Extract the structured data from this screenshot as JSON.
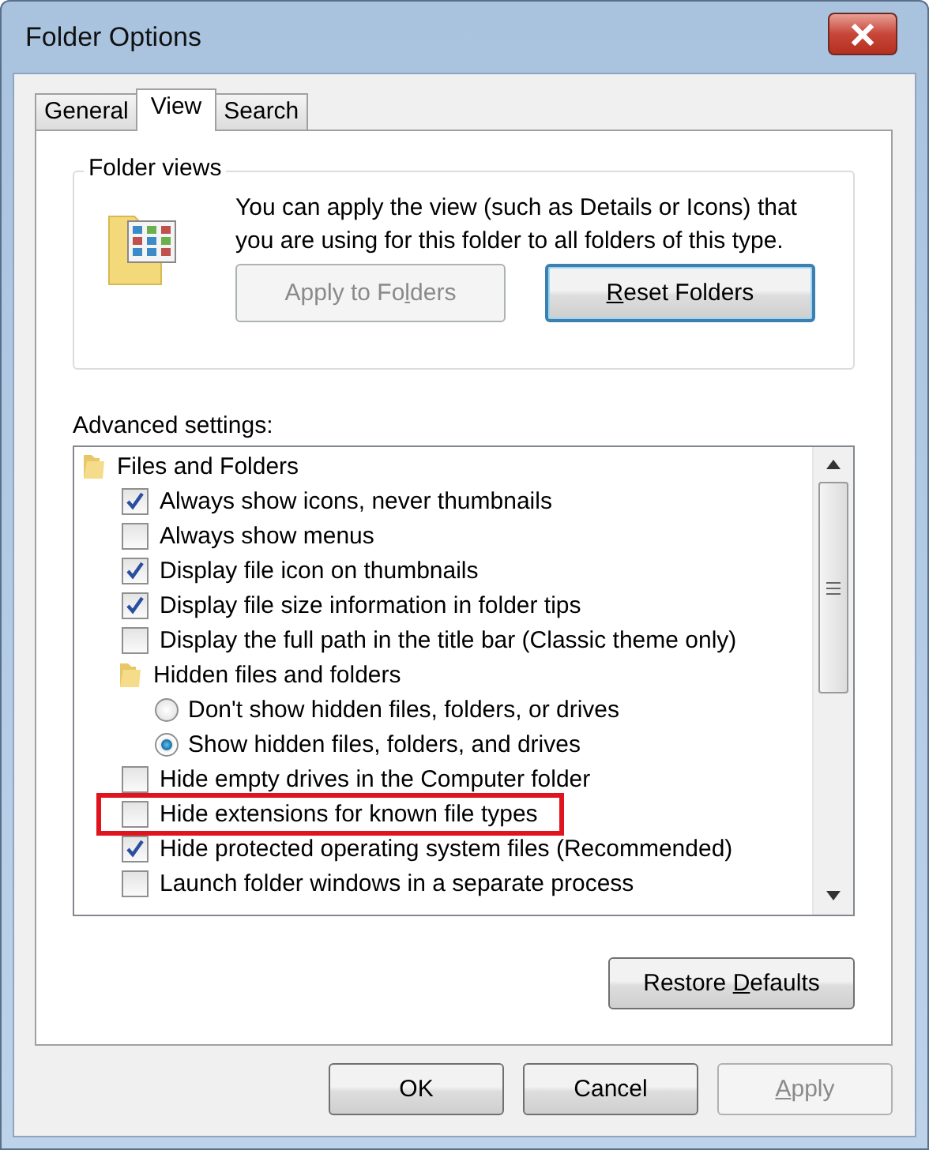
{
  "window": {
    "title": "Folder Options"
  },
  "tabs": [
    {
      "label": "General",
      "selected": false
    },
    {
      "label": "View",
      "selected": true
    },
    {
      "label": "Search",
      "selected": false
    }
  ],
  "folder_views": {
    "title": "Folder views",
    "description": "You can apply the view (such as Details or Icons) that you are using for this folder to all folders of this type.",
    "buttons": [
      {
        "pre": "Apply to Fo",
        "key": "l",
        "post": "ders",
        "disabled": true,
        "default": false
      },
      {
        "key": "R",
        "post": "eset Folders",
        "disabled": false,
        "default": true
      }
    ]
  },
  "advanced": {
    "label": "Advanced settings:",
    "items": [
      {
        "kind": "group",
        "label": "Files and Folders",
        "children": [
          {
            "kind": "checkbox",
            "label": "Always show icons, never thumbnails",
            "checked": true,
            "highlighted": false
          },
          {
            "kind": "checkbox",
            "label": "Always show menus",
            "checked": false,
            "highlighted": false
          },
          {
            "kind": "checkbox",
            "label": "Display file icon on thumbnails",
            "checked": true,
            "highlighted": false
          },
          {
            "kind": "checkbox",
            "label": "Display file size information in folder tips",
            "checked": true,
            "highlighted": false
          },
          {
            "kind": "checkbox",
            "label": "Display the full path in the title bar (Classic theme only)",
            "checked": false,
            "highlighted": false
          },
          {
            "kind": "group",
            "label": "Hidden files and folders",
            "children": [
              {
                "kind": "radio",
                "label": "Don't show hidden files, folders, or drives",
                "selected": false
              },
              {
                "kind": "radio",
                "label": "Show hidden files, folders, and drives",
                "selected": true
              }
            ]
          },
          {
            "kind": "checkbox",
            "label": "Hide empty drives in the Computer folder",
            "checked": false,
            "highlighted": false
          },
          {
            "kind": "checkbox",
            "label": "Hide extensions for known file types",
            "checked": false,
            "highlighted": true
          },
          {
            "kind": "checkbox",
            "label": "Hide protected operating system files (Recommended)",
            "checked": true,
            "highlighted": false
          },
          {
            "kind": "checkbox",
            "label": "Launch folder windows in a separate process",
            "checked": false,
            "highlighted": false
          }
        ]
      }
    ]
  },
  "restore_button": {
    "pre": "Restore ",
    "key": "D",
    "post": "efaults",
    "disabled": false
  },
  "buttons": [
    {
      "pre": "OK",
      "disabled": false
    },
    {
      "pre": "Cancel",
      "disabled": false
    },
    {
      "key": "A",
      "post": "pply",
      "disabled": true
    }
  ]
}
